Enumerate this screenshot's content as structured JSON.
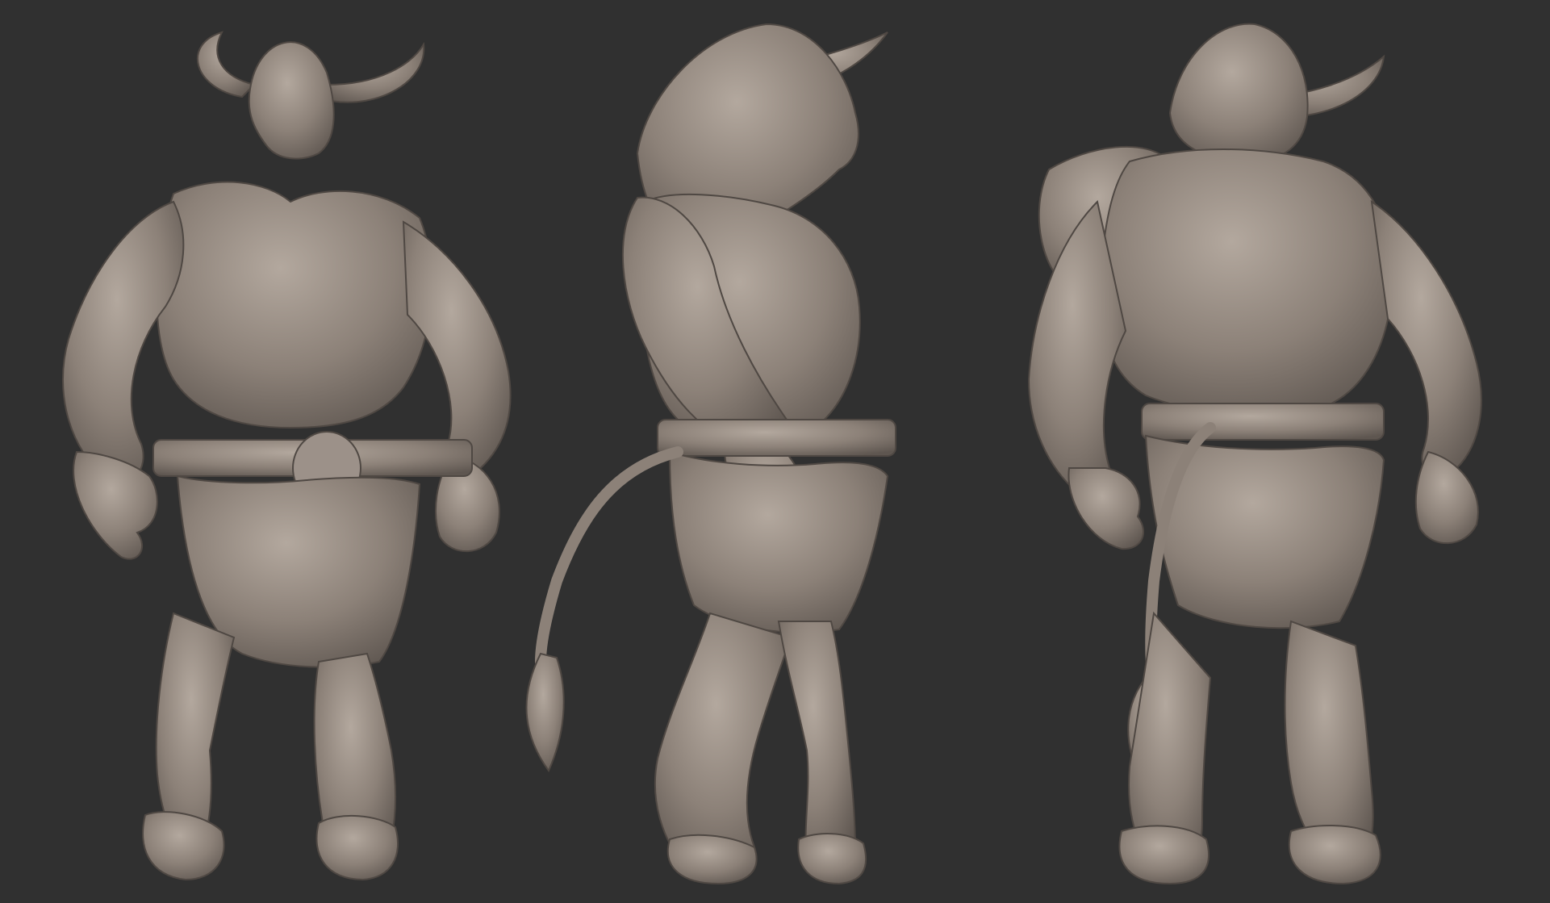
{
  "scene": {
    "background_color": "#303030",
    "model_color": "#8c8178",
    "model_shadow_color": "#5e5650",
    "model_highlight_color": "#b3a89e",
    "views": [
      {
        "name": "front-view"
      },
      {
        "name": "side-view"
      },
      {
        "name": "back-view"
      }
    ]
  }
}
